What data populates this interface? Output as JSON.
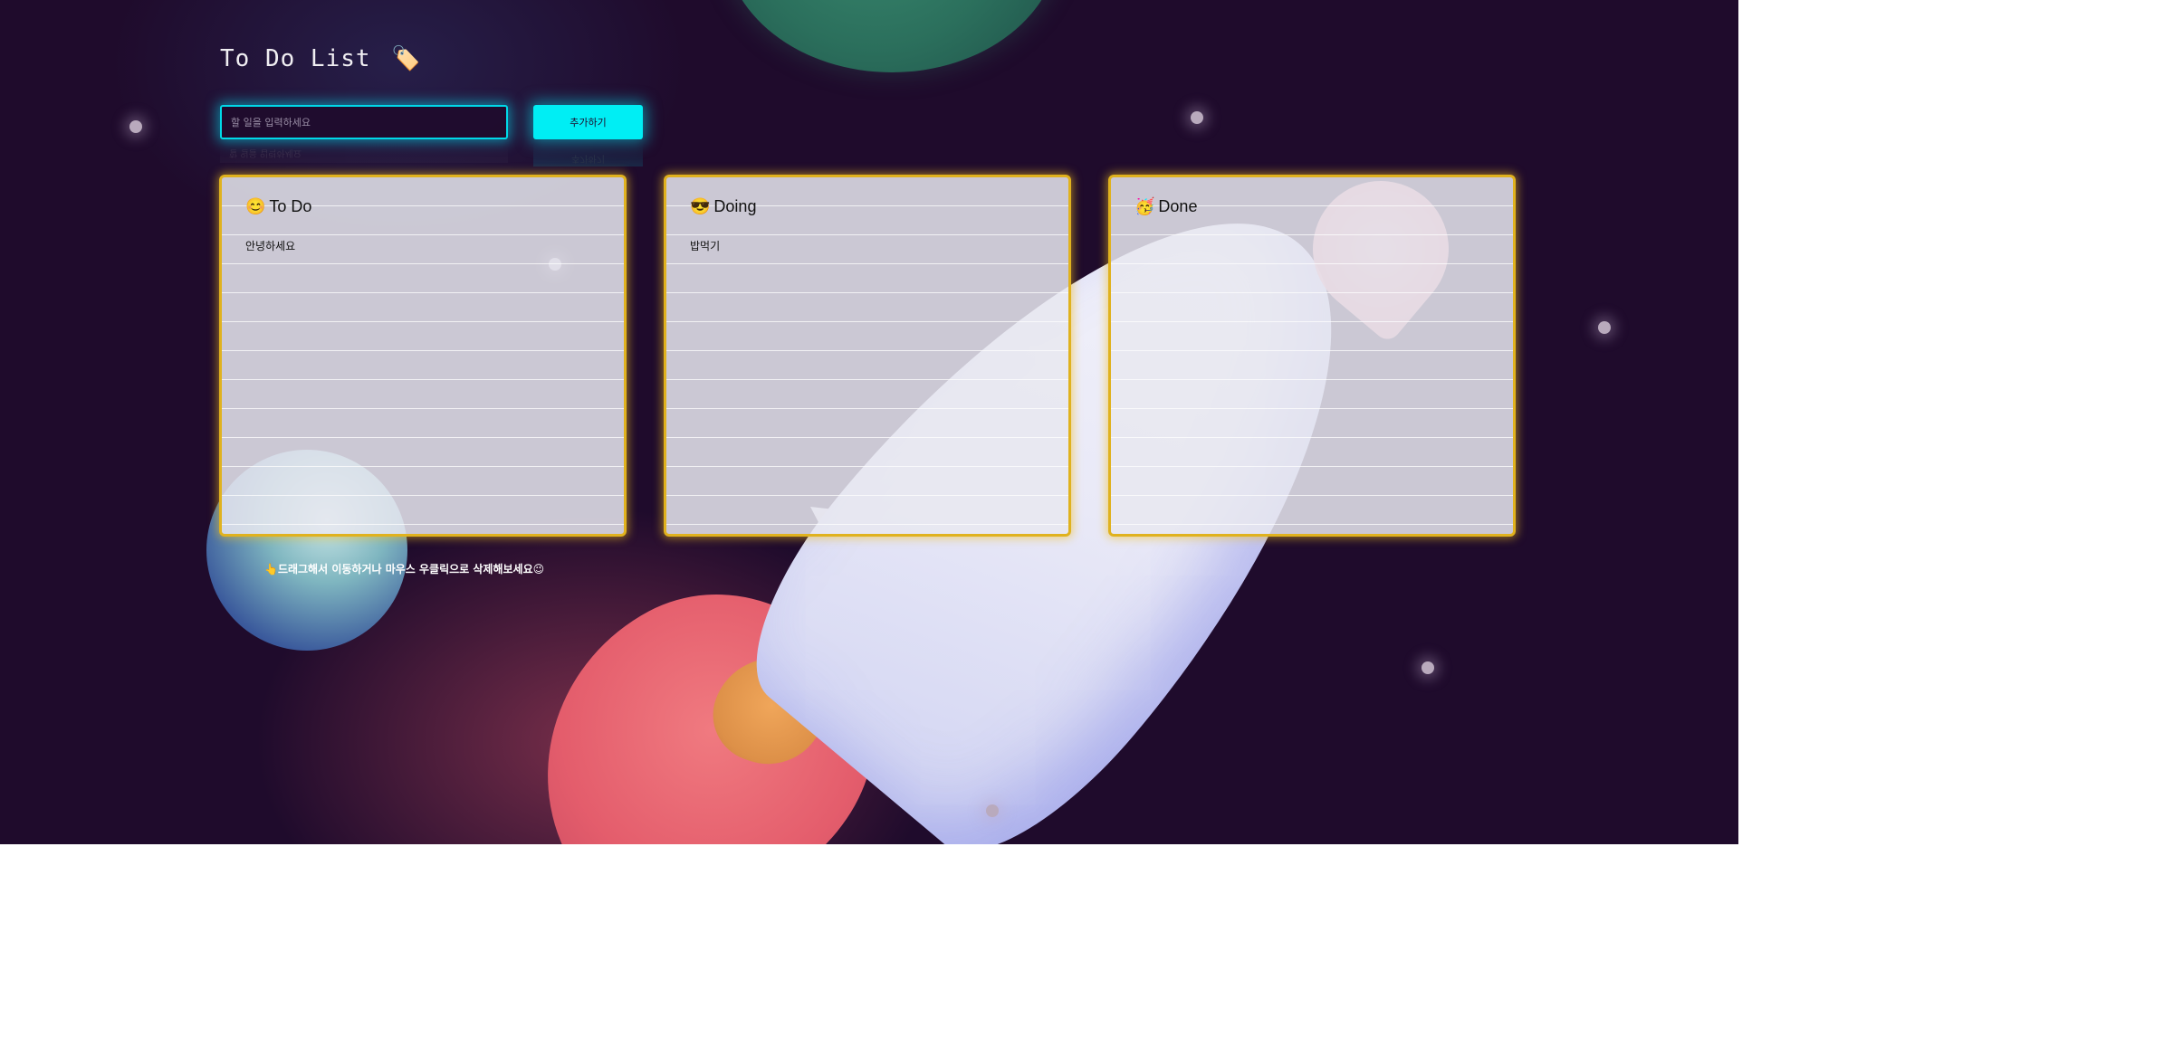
{
  "header": {
    "title": "To Do List",
    "title_icon": "🏷️"
  },
  "form": {
    "input_placeholder": "할 일을 입력하세요",
    "add_button_label": "추가하기"
  },
  "boards": {
    "todo": {
      "emoji": "😊",
      "title": "To Do",
      "items": [
        "안녕하세요"
      ]
    },
    "doing": {
      "emoji": "😎",
      "title": "Doing",
      "items": [
        "밥먹기"
      ]
    },
    "done": {
      "emoji": "🥳",
      "title": "Done",
      "items": []
    }
  },
  "footer": {
    "hint": "👆드래그해서 이동하거나 마우스 우클릭으로 삭제해보세요😉"
  },
  "colors": {
    "background": "#1f0b2c",
    "accent_cyan": "#00eef4",
    "board_border": "#e0b21e"
  }
}
